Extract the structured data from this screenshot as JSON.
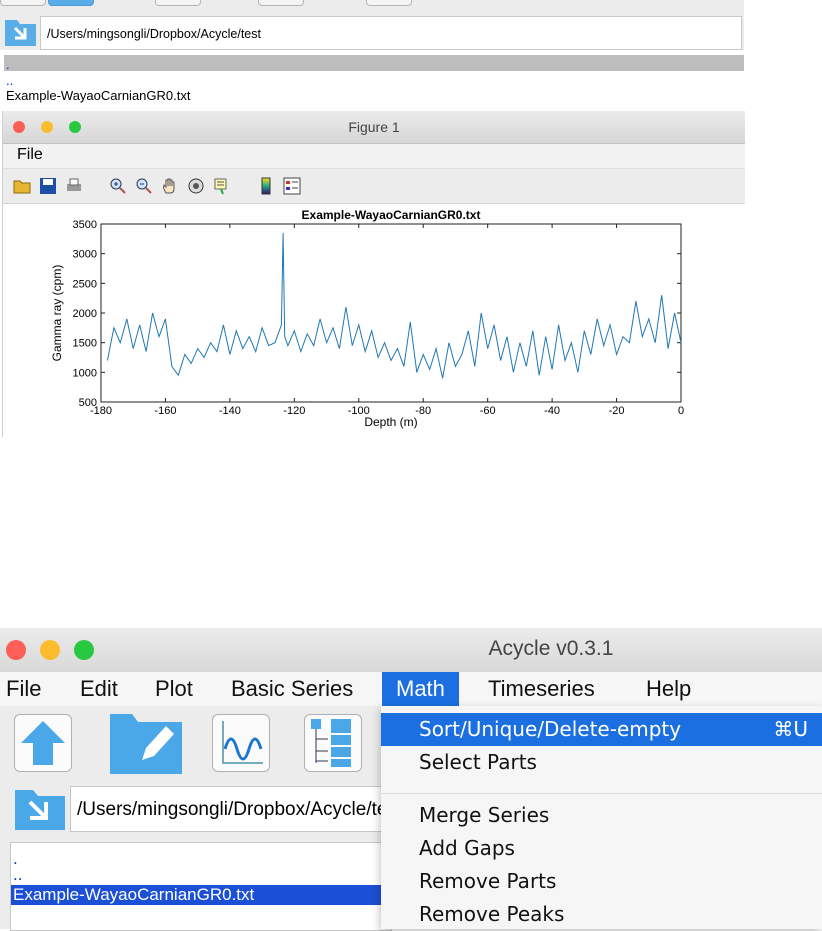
{
  "top_app": {
    "path": "/Users/mingsongli/Dropbox/Acycle/test",
    "file_list": [
      ".",
      "..",
      "Example-WayaoCarnianGR0.txt"
    ]
  },
  "figure_window": {
    "title": "Figure 1",
    "menu": [
      "File"
    ],
    "toolbar_icons": [
      "open-folder-icon",
      "save-icon",
      "print-icon",
      "zoom-in-icon",
      "zoom-out-icon",
      "pan-hand-icon",
      "rotate-3d-icon",
      "data-cursor-icon",
      "colorbar-icon",
      "legend-icon"
    ]
  },
  "chart_data": {
    "type": "line",
    "title": "Example-WayaoCarnianGR0.txt",
    "xlabel": "Depth (m)",
    "ylabel": "Gamma ray (cpm)",
    "xlim": [
      -180,
      0
    ],
    "ylim": [
      500,
      3500
    ],
    "xticks": [
      -180,
      -160,
      -140,
      -120,
      -100,
      -80,
      -60,
      -40,
      -20,
      0
    ],
    "yticks": [
      500,
      1000,
      1500,
      2000,
      2500,
      3000,
      3500
    ],
    "color": "#1f77b4",
    "x": [
      -178,
      -176,
      -174,
      -172,
      -170,
      -168,
      -166,
      -164,
      -162,
      -160,
      -158,
      -156,
      -154,
      -152,
      -150,
      -148,
      -146,
      -144,
      -142,
      -140,
      -138,
      -136,
      -134,
      -132,
      -130,
      -128,
      -126,
      -124,
      -123.5,
      -123,
      -122,
      -120,
      -118,
      -116,
      -114,
      -112,
      -110,
      -108,
      -106,
      -104,
      -102,
      -100,
      -98,
      -96,
      -94,
      -92,
      -90,
      -88,
      -86,
      -84,
      -82,
      -80,
      -78,
      -76,
      -74,
      -72,
      -70,
      -68,
      -66,
      -64,
      -62,
      -60,
      -58,
      -56,
      -54,
      -52,
      -50,
      -48,
      -46,
      -44,
      -42,
      -40,
      -38,
      -36,
      -34,
      -32,
      -30,
      -28,
      -26,
      -24,
      -22,
      -20,
      -18,
      -16,
      -14,
      -12,
      -10,
      -8,
      -6,
      -4,
      -2,
      0
    ],
    "y": [
      1200,
      1750,
      1500,
      1900,
      1400,
      1800,
      1350,
      2000,
      1600,
      1900,
      1100,
      950,
      1300,
      1150,
      1400,
      1250,
      1500,
      1350,
      1800,
      1300,
      1700,
      1400,
      1600,
      1350,
      1750,
      1450,
      1500,
      1800,
      3350,
      1600,
      1450,
      1700,
      1350,
      1650,
      1450,
      1900,
      1500,
      1750,
      1400,
      2100,
      1450,
      1800,
      1350,
      1700,
      1250,
      1500,
      1200,
      1400,
      1100,
      1850,
      1000,
      1300,
      1050,
      1400,
      900,
      1500,
      1100,
      1300,
      1700,
      1100,
      2000,
      1400,
      1800,
      1200,
      1600,
      1000,
      1500,
      1100,
      1700,
      950,
      1600,
      1050,
      1800,
      1200,
      1500,
      1000,
      1700,
      1300,
      1900,
      1450,
      1800,
      1300,
      1600,
      1500,
      2200,
      1600,
      1900,
      1500,
      2300,
      1400,
      2000,
      1500
    ]
  },
  "acycle": {
    "title": "Acycle v0.3.1",
    "menu": [
      "File",
      "Edit",
      "Plot",
      "Basic Series",
      "Math",
      "Timeseries",
      "Help"
    ],
    "active_menu": "Math",
    "toolbar_icons": [
      "up-arrow-icon",
      "edit-folder-icon",
      "plot-wave-icon",
      "tree-structure-icon"
    ],
    "path": "/Users/mingsongli/Dropbox/Acycle/test",
    "file_list": [
      ".",
      "..",
      "Example-WayaoCarnianGR0.txt"
    ],
    "selected_file": "Example-WayaoCarnianGR0.txt"
  },
  "math_menu": {
    "items": [
      {
        "label": "Sort/Unique/Delete-empty",
        "shortcut": "⌘U"
      },
      {
        "label": "Select Parts",
        "shortcut": ""
      },
      {
        "label": "Merge Series",
        "shortcut": ""
      },
      {
        "label": "Add Gaps",
        "shortcut": ""
      },
      {
        "label": "Remove Parts",
        "shortcut": ""
      },
      {
        "label": "Remove Peaks",
        "shortcut": ""
      }
    ]
  }
}
